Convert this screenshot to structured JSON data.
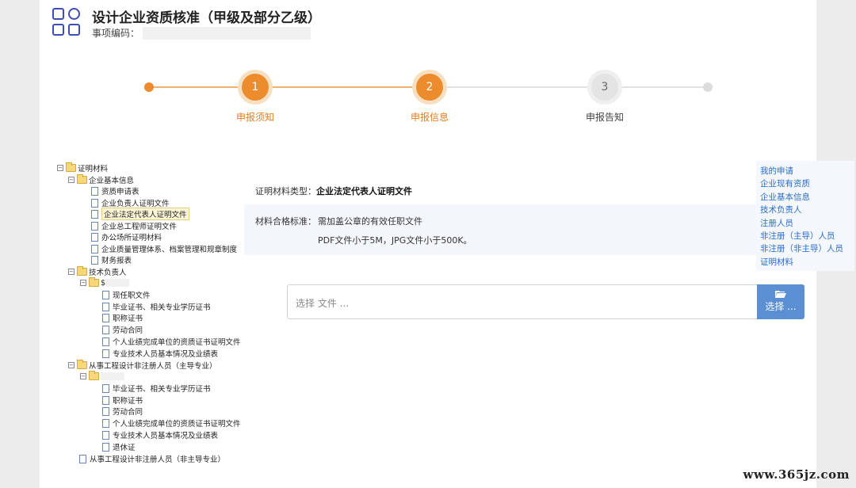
{
  "header": {
    "title": "设计企业资质核准（甲级及部分乙级）",
    "code_label": "事项编码："
  },
  "steps": [
    {
      "number": "1",
      "label": "申报须知"
    },
    {
      "number": "2",
      "label": "申报信息"
    },
    {
      "number": "3",
      "label": "申报告知"
    }
  ],
  "colors": {
    "accent": "#ec8c2c",
    "link": "#2a6ec7",
    "button": "#5b8fd3"
  },
  "tree": {
    "root": "证明材料",
    "basic": {
      "label": "企业基本信息",
      "items": [
        "资质申请表",
        "企业负责人证明文件",
        "企业法定代表人证明文件",
        "企业总工程师证明文件",
        "办公场所证明材料",
        "企业质量管理体系、档案管理和规章制度",
        "财务报表"
      ]
    },
    "tech": {
      "label": "技术负责人",
      "person_prefix": "$",
      "items": [
        "现任职文件",
        "毕业证书、相关专业学历证书",
        "职称证书",
        "劳动合同",
        "个人业绩完成单位的资质证书证明文件",
        "专业技术人员基本情况及业绩表"
      ]
    },
    "main_major": {
      "label": "从事工程设计非注册人员（主导专业）",
      "items": [
        "毕业证书、相关专业学历证书",
        "职称证书",
        "劳动合同",
        "个人业绩完成单位的资质证书证明文件",
        "专业技术人员基本情况及业绩表",
        "退休证"
      ]
    },
    "non_main": "从事工程设计非注册人员（非主导专业）"
  },
  "material": {
    "type_label": "证明材料类型：",
    "type_value": "企业法定代表人证明文件",
    "standard_label": "材料合格标准：",
    "standard_line1": "需加盖公章的有效任职文件",
    "standard_line2": "PDF文件小于5M，JPG文件小于500K。"
  },
  "upload": {
    "placeholder": "选择 文件 ...",
    "button_label": "选择 ..."
  },
  "sidenav": [
    "我的申请",
    "企业现有资质",
    "企业基本信息",
    "技术负责人",
    "注册人员",
    "非注册（主导）人员",
    "非注册（非主导）人员",
    "证明材料"
  ],
  "watermark": "www.365jz.com"
}
